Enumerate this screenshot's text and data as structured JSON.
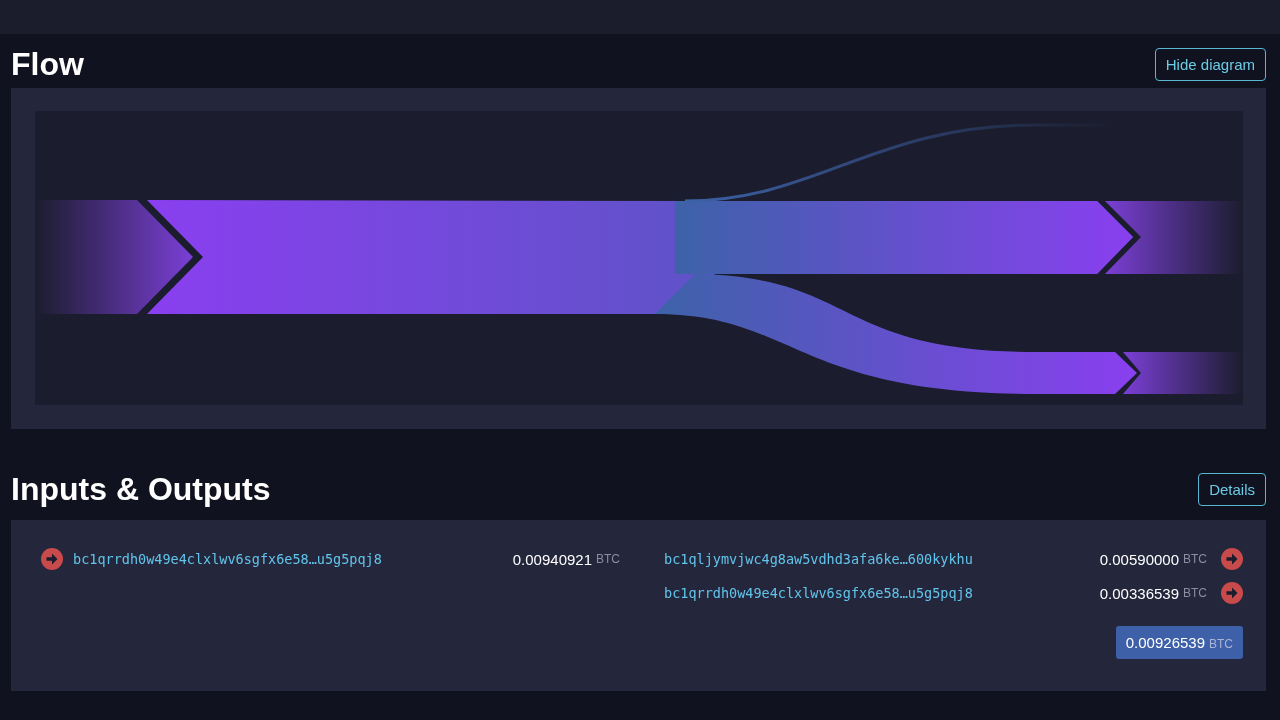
{
  "flow": {
    "title": "Flow",
    "button": "Hide diagram"
  },
  "io": {
    "title": "Inputs & Outputs",
    "button": "Details",
    "inputs": [
      {
        "address": "bc1qrrdh0w49e4clxlwv6sgfx6e58…u5g5pqj8",
        "amount": "0.00940921",
        "unit": "BTC"
      }
    ],
    "outputs": [
      {
        "address": "bc1qljymvjwc4g8aw5vdhd3afa6ke…600kykhu",
        "amount": "0.00590000",
        "unit": "BTC"
      },
      {
        "address": "bc1qrrdh0w49e4clxlwv6sgfx6e58…u5g5pqj8",
        "amount": "0.00336539",
        "unit": "BTC"
      }
    ],
    "total": {
      "amount": "0.00926539",
      "unit": "BTC"
    }
  }
}
